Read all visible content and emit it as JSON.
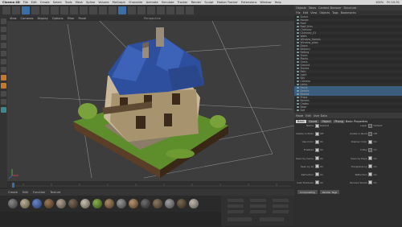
{
  "menubar": {
    "app_name": "Cinema 4D",
    "items": [
      "File",
      "Edit",
      "Create",
      "Select",
      "Tools",
      "Mesh",
      "Spline",
      "Volume",
      "MoGraph",
      "Character",
      "Animate",
      "Simulate",
      "Tracker",
      "Render",
      "Sculpt",
      "Motion Tracker",
      "Extensions",
      "Window",
      "Help"
    ],
    "right": [
      "100%",
      "Fri 10:31"
    ]
  },
  "viewport": {
    "menu": [
      "View",
      "Cameras",
      "Display",
      "Options",
      "Filter",
      "Panel"
    ],
    "title": "Perspective"
  },
  "material_manager": {
    "menu": [
      "Create",
      "Edit",
      "Function",
      "Texture"
    ]
  },
  "object_manager": {
    "tabs": [
      "Objects",
      "Takes",
      "Content Browser",
      "Structure"
    ],
    "menu": [
      "File",
      "Edit",
      "View",
      "Objects",
      "Tags",
      "Bookmarks"
    ],
    "rows": [
      "Scene",
      "House",
      "Roof",
      "Roof_tiles",
      "Chimney",
      "Chimney_01",
      "Walls",
      "Window_frames",
      "Window_glass",
      "Doors",
      "Balcony",
      "Railing",
      "Stairs",
      "Plants",
      "Grass",
      "Ground",
      "Stones",
      "Path",
      "Light",
      "Sky",
      "Camera",
      "Lamp",
      "Fence",
      "Details",
      "Beams",
      "Props",
      "Barrels",
      "Crates",
      "Base",
      "Soil"
    ]
  },
  "attributes": {
    "menu": [
      "Mode",
      "Edit",
      "User Data"
    ],
    "tabs": [
      "Basic",
      "Coord.",
      "Object",
      "Phong"
    ],
    "active_tab": "Basic",
    "section": "Basic Properties",
    "left_rows": [
      "Name",
      "Layer",
      "Visible in Editor",
      "Visible in Renderer",
      "Use Color",
      "Display Color",
      "Enabled",
      "X-Ray",
      "Seen by Camera",
      "Seen by Rays",
      "Seen by GI",
      "Transparency",
      "Refraction",
      "Reflection",
      "Cast Shadows",
      "Receive Shadows"
    ],
    "right_rows": [
      "Default",
      "Default",
      "Off",
      "Off",
      "On",
      "On",
      "On",
      "On",
      "On",
      "On",
      "On",
      "On",
      "On",
      "On",
      "On",
      "On"
    ],
    "buttons": [
      "Compositing",
      "Render Tags"
    ]
  },
  "colors": {
    "accent": "#3a6ea5",
    "orange": "#c9772a",
    "roof": "#2d4f9e",
    "grass": "#5e8d2c"
  }
}
